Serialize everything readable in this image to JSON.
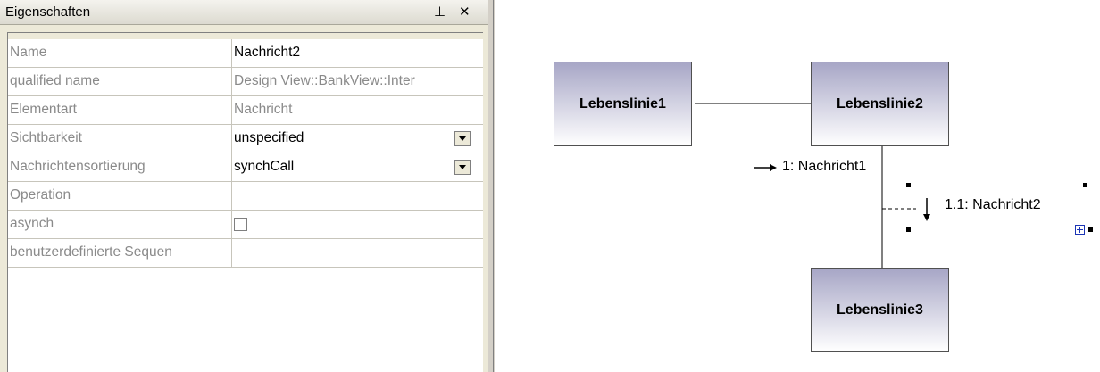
{
  "panel": {
    "title": "Eigenschaften",
    "pin_glyph": "⊥",
    "close_glyph": "✕",
    "rows": [
      {
        "key": "Name",
        "value": "Nachricht2",
        "kind": "text",
        "readonly": false
      },
      {
        "key": "qualified name",
        "value": "Design View::BankView::Inter",
        "kind": "text",
        "readonly": true
      },
      {
        "key": "Elementart",
        "value": "Nachricht",
        "kind": "text",
        "readonly": true
      },
      {
        "key": "Sichtbarkeit",
        "value": "unspecified",
        "kind": "dropdown",
        "readonly": false
      },
      {
        "key": "Nachrichtensortierung",
        "value": "synchCall",
        "kind": "dropdown",
        "readonly": false
      },
      {
        "key": "Operation",
        "value": "",
        "kind": "text",
        "readonly": false
      },
      {
        "key": "asynch",
        "value": "",
        "kind": "checkbox",
        "readonly": false,
        "checked": false
      },
      {
        "key": "benutzerdefinierte Sequen",
        "value": "",
        "kind": "text",
        "readonly": false
      }
    ]
  },
  "diagram": {
    "lifelines": [
      {
        "label": "Lebenslinie1"
      },
      {
        "label": "Lebenslinie2"
      },
      {
        "label": "Lebenslinie3"
      }
    ],
    "messages": [
      {
        "label": "1: Nachricht1",
        "arrow": "→"
      },
      {
        "label": "1.1: Nachricht2",
        "arrow": "↓"
      }
    ],
    "colors": {
      "lifeline_top": "#a7a6c6",
      "lifeline_bottom": "#ffffff",
      "selection": "#1c35b5"
    }
  }
}
